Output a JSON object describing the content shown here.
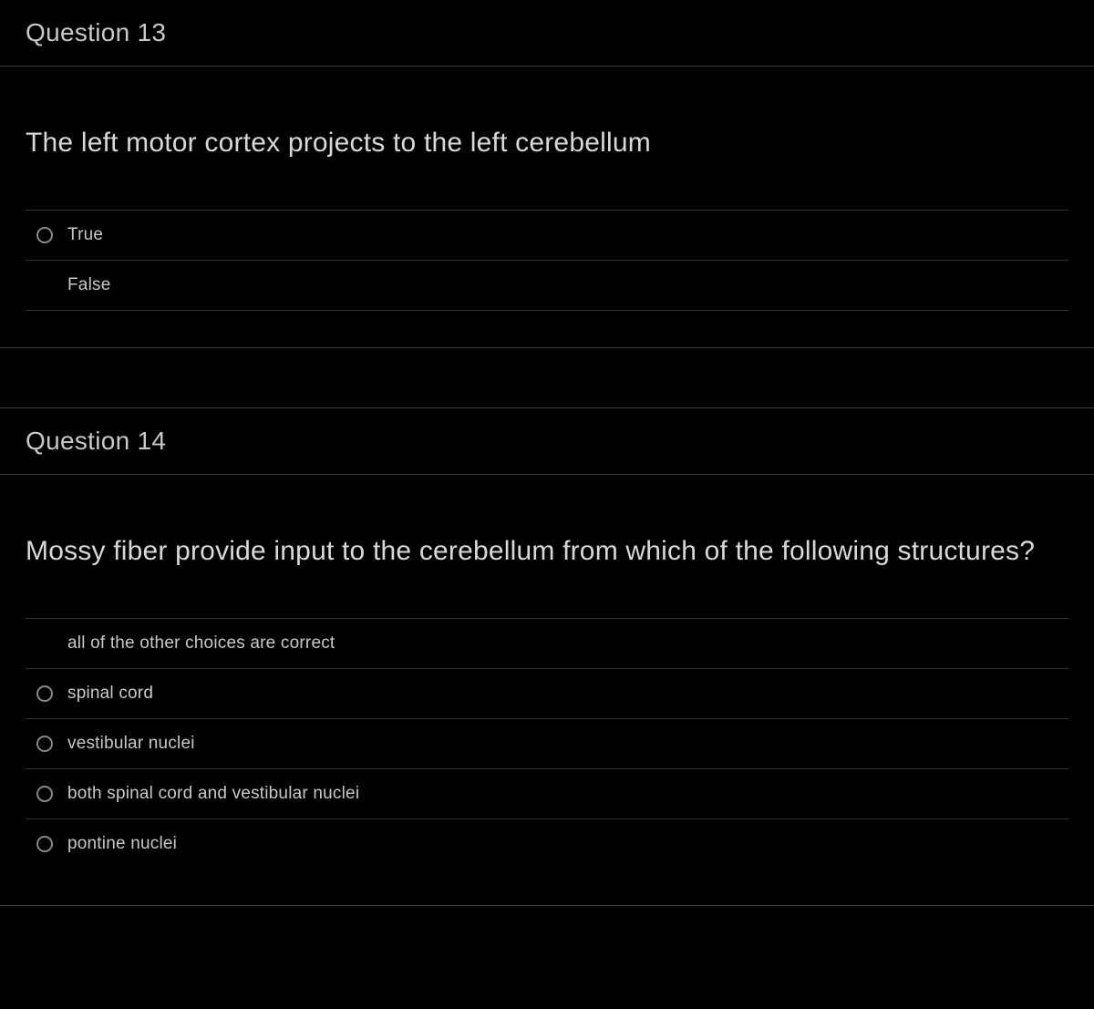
{
  "questions": [
    {
      "title": "Question 13",
      "text": "The left motor cortex projects to the left cerebellum",
      "answers": [
        {
          "label": "True",
          "radio": true
        },
        {
          "label": "False",
          "radio": false
        }
      ]
    },
    {
      "title": "Question 14",
      "text": "Mossy fiber provide input to the cerebellum from which of the following structures?",
      "answers": [
        {
          "label": "all of the other choices are correct",
          "radio": false
        },
        {
          "label": "spinal cord",
          "radio": true
        },
        {
          "label": "vestibular nuclei",
          "radio": true
        },
        {
          "label": "both spinal cord and vestibular nuclei",
          "radio": true
        },
        {
          "label": "pontine nuclei",
          "radio": true
        }
      ]
    }
  ]
}
